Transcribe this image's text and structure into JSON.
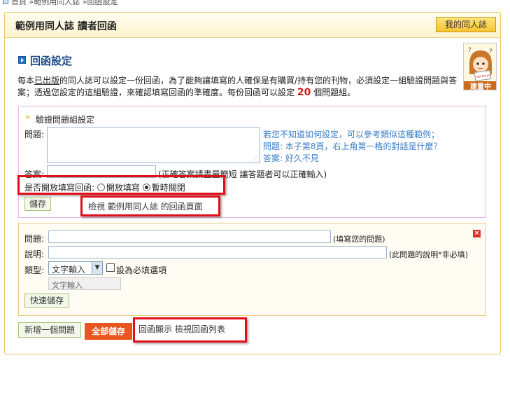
{
  "breadcrumb": {
    "home": "首頁",
    "sep1": "»",
    "section": "範例用同人誌",
    "sep2": "»",
    "current": "回函設定"
  },
  "header": {
    "title": "範例用同人誌 讀者回函",
    "my_button": "我的同人誌"
  },
  "section": {
    "title": "回函設定"
  },
  "avatar": {
    "badge": "建置中",
    "sign": "NO Access"
  },
  "description": {
    "part1": "每本",
    "underlined": "已出版",
    "part2": "的同人誌可以設定一份回函，為了能夠讓填寫的人確保是有購買/持有您的刊物，必須設定一組驗證問題與答案；透過您設定的這組驗證，來確認填寫回函的準確度。每份回函可以設定",
    "count": "20",
    "part3": "個問題組。"
  },
  "verify": {
    "heading": "驗證問題組設定",
    "question_label": "問題:",
    "answer_label": "答案:",
    "answer_note": "(正確答案請盡量簡短 讓答題者可以正確輸入)",
    "hint_line1": "若您不知道如何設定，可以參考類似這種範例；",
    "hint_q_label": "問題:",
    "hint_q_text": "本子第8頁，右上角第一格的對話是什麼？",
    "hint_a_label": "答案:",
    "hint_a_text": "好久不見",
    "open_label": "是否開放填寫回函:",
    "open_option": "開放填寫",
    "close_option": "暫時關閉",
    "save": "儲存",
    "view_link": "檢視 範例用同人誌 的回函頁面"
  },
  "question_block": {
    "question_label": "問題:",
    "question_note": "(填寫您的問題)",
    "desc_label": "說明:",
    "desc_note": "(此問題的說明*非必填)",
    "type_label": "類型:",
    "type_value": "文字輸入",
    "required_label": "設為必填選項",
    "preview_value": "文字輸入",
    "quick_save": "快速儲存",
    "close_symbol": "×"
  },
  "footer": {
    "add_question": "新增一個問題",
    "save_all": "全部儲存",
    "link_display": "回函顯示",
    "link_list": "檢視回函列表"
  },
  "colors": {
    "accent_red": "#e00f1a",
    "link": "#1a5fb4",
    "save_all": "#e9551c"
  }
}
